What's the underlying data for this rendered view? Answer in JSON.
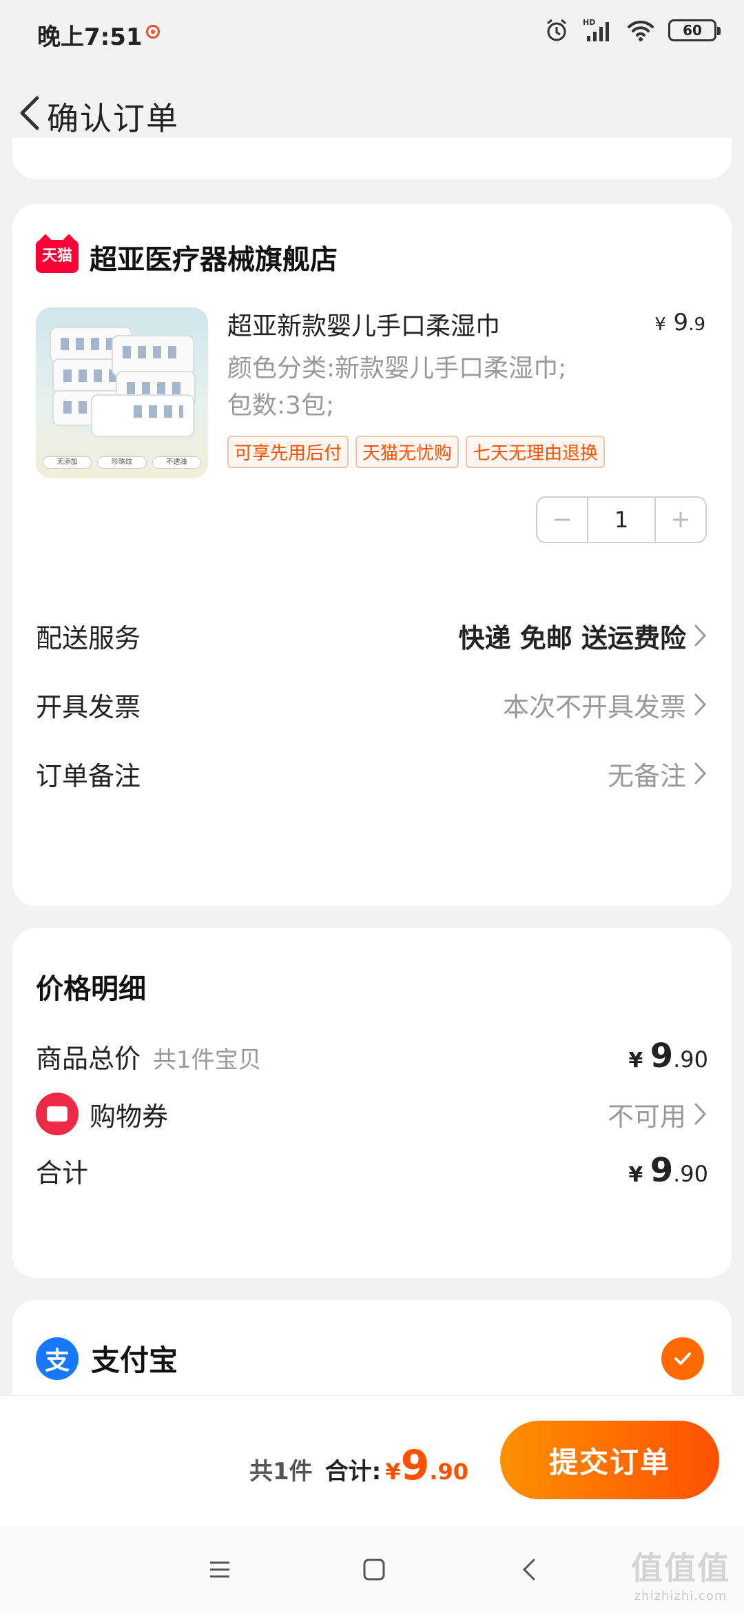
{
  "status_bar": {
    "time": "晚上7:51",
    "network": "HD",
    "battery": "60"
  },
  "header": {
    "title": "确认订单"
  },
  "store": {
    "badge": "天猫",
    "name": "超亚医疗器械旗舰店",
    "product": {
      "title": "超亚新款婴儿手口柔湿巾",
      "price_symbol": "¥",
      "price_int": "9",
      "price_dec": ".9",
      "spec": "颜色分类:新款婴儿手口柔湿巾;包数:3包;",
      "tags": [
        "可享先用后付",
        "天猫无忧购",
        "七天无理由退换"
      ],
      "quantity": "1",
      "image_labels": [
        "无添加",
        "珍珠纹",
        "不透油"
      ]
    },
    "rows": [
      {
        "label": "配送服务",
        "value": "快递 免邮 送运费险"
      },
      {
        "label": "开具发票",
        "value": "本次不开具发票"
      },
      {
        "label": "订单备注",
        "value": "无备注"
      }
    ]
  },
  "price_detail": {
    "title": "价格明细",
    "goods_total_label": "商品总价",
    "goods_count": "共1件宝贝",
    "goods_total": {
      "symbol": "¥",
      "int": "9",
      "dec": ".90"
    },
    "coupon_label": "购物券",
    "coupon_value": "不可用",
    "sum_label": "合计",
    "sum": {
      "symbol": "¥",
      "int": "9",
      "dec": ".90"
    }
  },
  "payment": {
    "method": "支付宝",
    "icon_glyph": "支",
    "selected": true
  },
  "submit_bar": {
    "count": "共1件",
    "total_label": "合计:",
    "total": {
      "symbol": "¥",
      "int": "9",
      "dec": ".90"
    },
    "button": "提交订单"
  },
  "watermark": {
    "mark": "值值值",
    "site": "zhizhizhi.com"
  },
  "colors": {
    "accent": "#ff5000",
    "tmall": "#ff0036",
    "alipay": "#1677ff"
  }
}
